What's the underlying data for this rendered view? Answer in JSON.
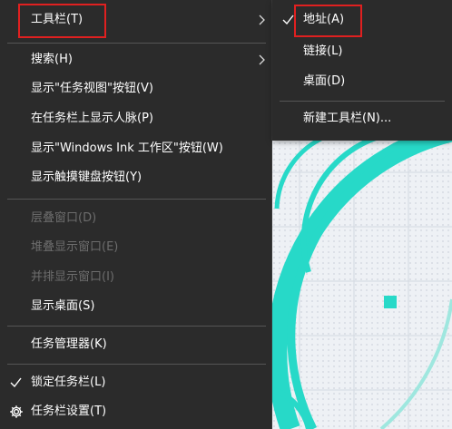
{
  "menu": {
    "items": [
      {
        "label": "工具栏(T)",
        "submenu": true
      },
      {
        "label": "搜索(H)",
        "submenu": true
      },
      {
        "label": "显示\"任务视图\"按钮(V)"
      },
      {
        "label": "在任务栏上显示人脉(P)"
      },
      {
        "label": "显示\"Windows Ink 工作区\"按钮(W)"
      },
      {
        "label": "显示触摸键盘按钮(Y)"
      },
      {
        "label": "层叠窗口(D)",
        "disabled": true
      },
      {
        "label": "堆叠显示窗口(E)",
        "disabled": true
      },
      {
        "label": "并排显示窗口(I)",
        "disabled": true
      },
      {
        "label": "显示桌面(S)"
      },
      {
        "label": "任务管理器(K)"
      },
      {
        "label": "锁定任务栏(L)",
        "checked": true
      },
      {
        "label": "任务栏设置(T)",
        "icon": "gear-icon"
      }
    ]
  },
  "submenu": {
    "items": [
      {
        "label": "地址(A)",
        "checked": true
      },
      {
        "label": "链接(L)"
      },
      {
        "label": "桌面(D)"
      },
      {
        "label": "新建工具栏(N)..."
      }
    ]
  },
  "colors": {
    "menu_bg": "#2b2b2b",
    "highlight_box": "#e02020",
    "accent": "#27d9c8"
  }
}
